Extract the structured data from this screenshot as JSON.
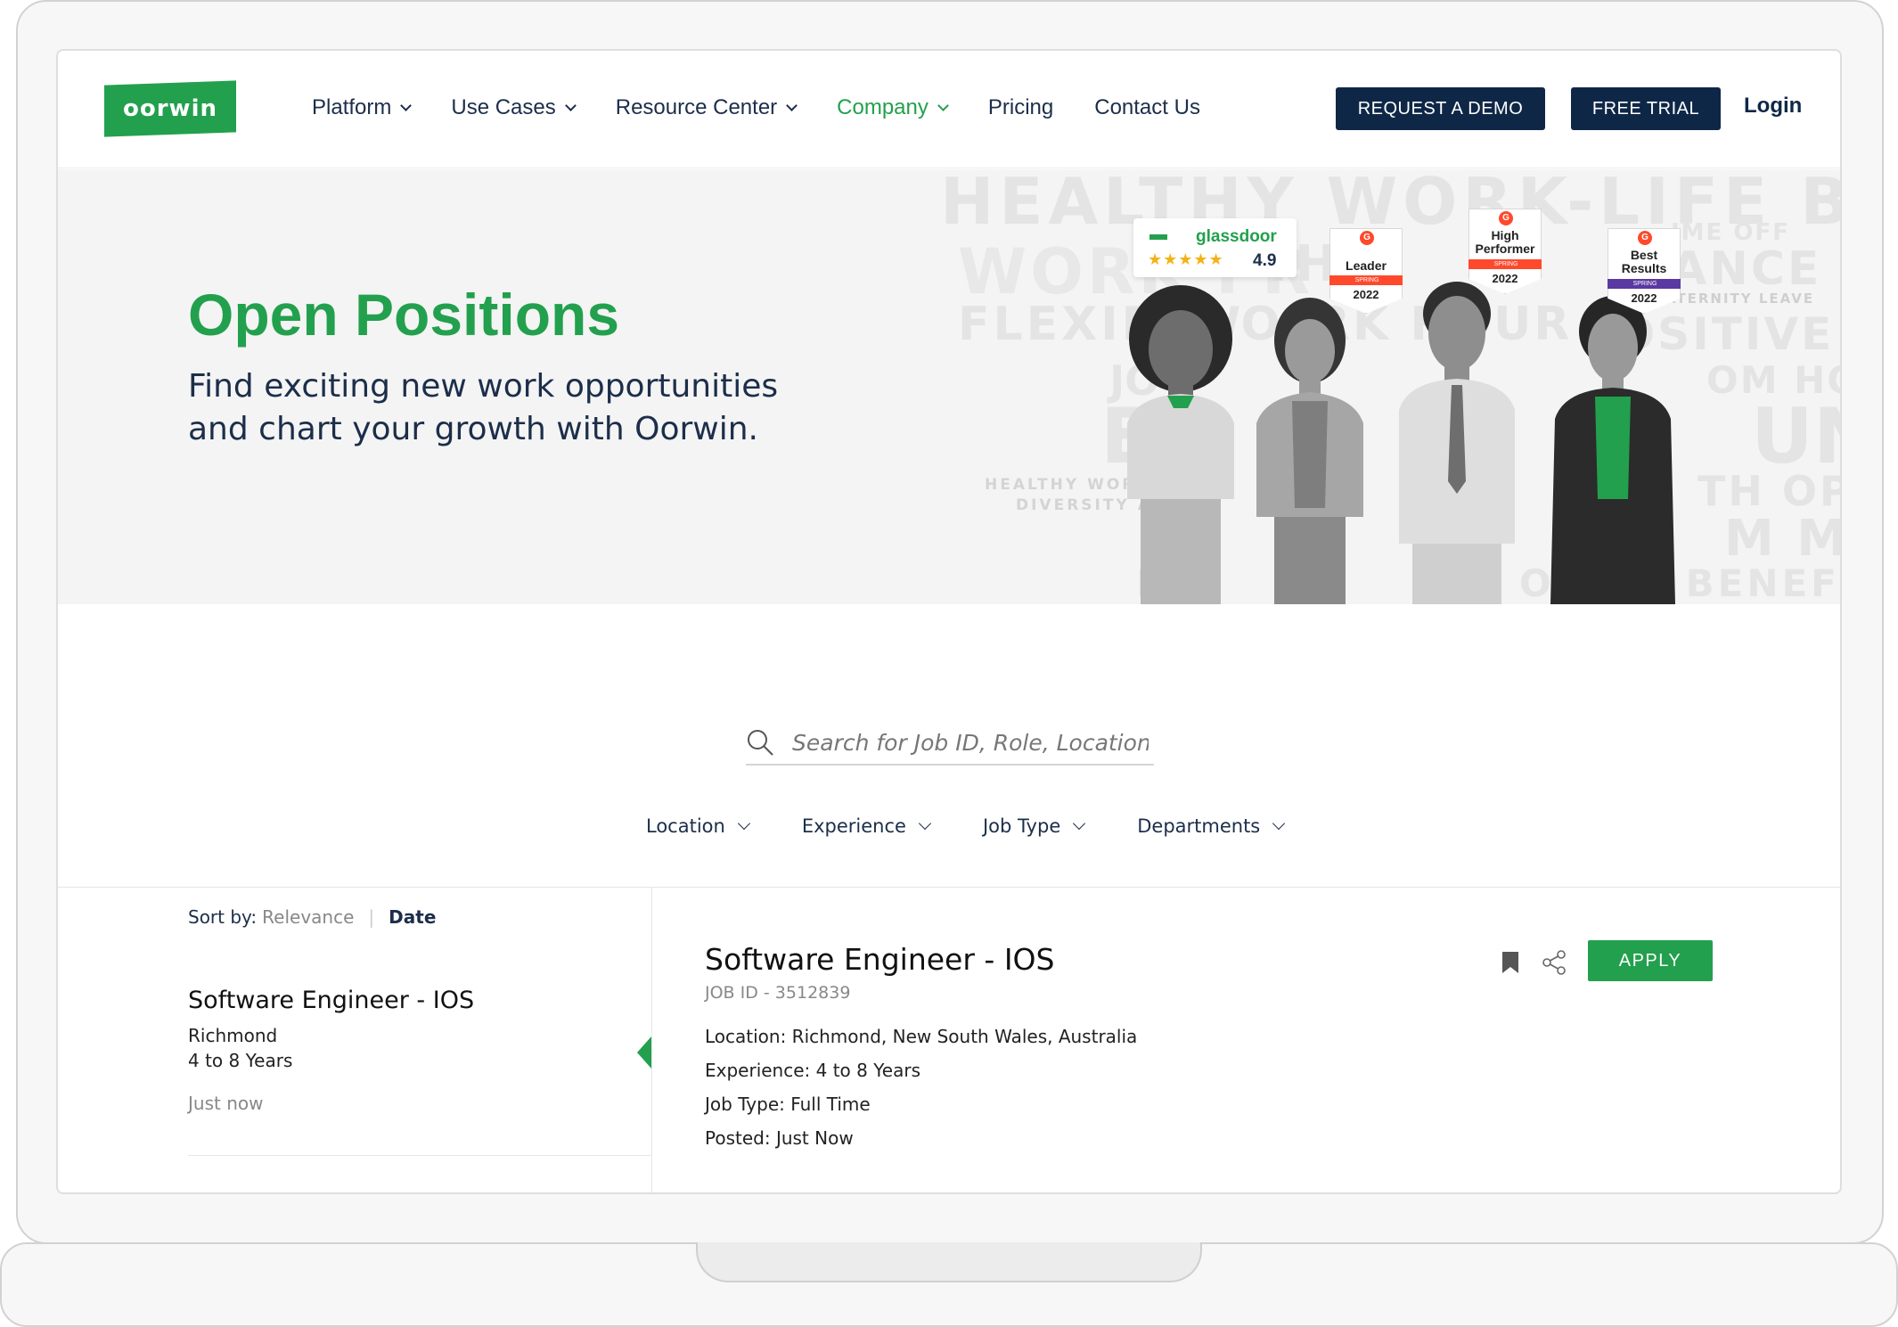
{
  "brand": {
    "logo_text": "oorwin",
    "accent_color": "#23a04d",
    "navy_color": "#0f2747"
  },
  "nav": {
    "items": [
      {
        "label": "Platform",
        "dropdown": true,
        "active": false
      },
      {
        "label": "Use Cases",
        "dropdown": true,
        "active": false
      },
      {
        "label": "Resource Center",
        "dropdown": true,
        "active": false
      },
      {
        "label": "Company",
        "dropdown": true,
        "active": true
      },
      {
        "label": "Pricing",
        "dropdown": false,
        "active": false
      },
      {
        "label": "Contact Us",
        "dropdown": false,
        "active": false
      }
    ],
    "demo_label": "REQUEST A DEMO",
    "trial_label": "FREE TRIAL",
    "login_label": "Login"
  },
  "hero": {
    "title": "Open Positions",
    "subtitle": "Find exciting new work opportunities and chart your growth with Oorwin.",
    "background_words": [
      "HEALTHY WORK-LIFE BA",
      "WORK FR",
      "TH",
      "ANCE",
      "FLEXIBL",
      "WO",
      "RK HOUR",
      "POSITIVE W",
      "JO",
      "OM HOME",
      "EQ",
      "UN",
      "HEALTHY WORK-LIF",
      "DIVERSITY AND",
      "TH OPP",
      "M ME",
      "E",
      "ON",
      "ND BENEFIT",
      "IME OFF",
      "& PATERNITY LEAVE"
    ],
    "glassdoor": {
      "name": "glassdoor",
      "stars": "★★★★★",
      "rating": "4.9"
    },
    "g2_badges": [
      {
        "title": "Leader",
        "ribbon": "SPRING",
        "year": "2022",
        "ribbon_color": "#ff492c"
      },
      {
        "title": "High Performer",
        "ribbon": "SPRING",
        "year": "2022",
        "ribbon_color": "#ff492c"
      },
      {
        "title": "Best Results",
        "ribbon": "SPRING",
        "year": "2022",
        "ribbon_color": "#5a39a2"
      }
    ]
  },
  "search": {
    "placeholder": "Search for Job ID, Role, Location..."
  },
  "filters": [
    "Location",
    "Experience",
    "Job Type",
    "Departments"
  ],
  "sort": {
    "label": "Sort by:",
    "options": [
      "Relevance",
      "Date"
    ],
    "active": "Date"
  },
  "job_list": [
    {
      "title": "Software Engineer - IOS",
      "location": "Richmond",
      "experience": "4 to 8 Years",
      "posted": "Just now"
    }
  ],
  "detail": {
    "title": "Software Engineer - IOS",
    "job_id": "JOB ID - 3512839",
    "location": "Location: Richmond, New South Wales, Australia",
    "experience": "Experience: 4 to 8 Years",
    "job_type": "Job Type: Full Time",
    "posted": "Posted: Just Now",
    "apply_label": "APPLY"
  }
}
